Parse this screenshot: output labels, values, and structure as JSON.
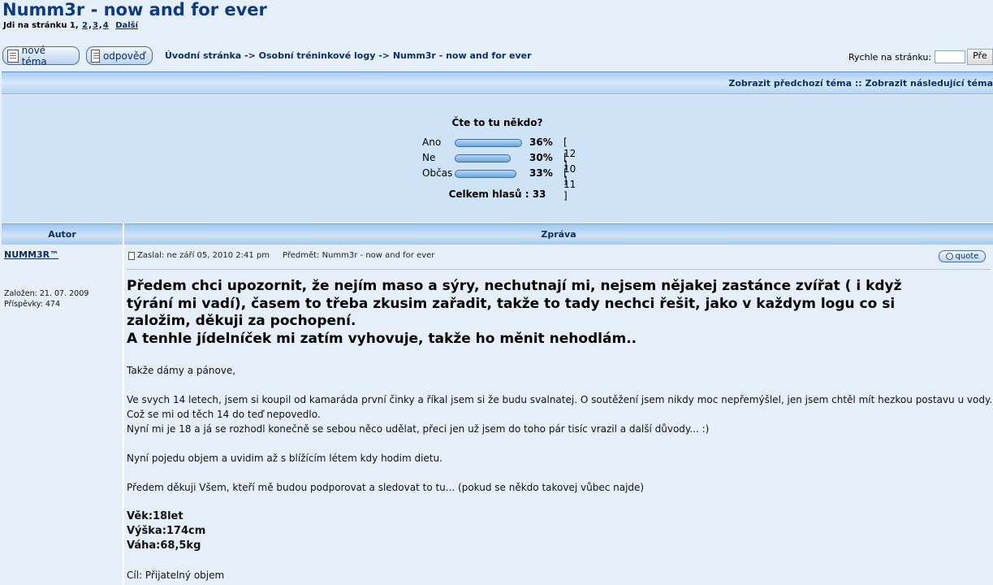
{
  "topic": {
    "title": "Numm3r - now and for ever"
  },
  "pager": {
    "prefix": "Jdi na stránku 1,",
    "pages": [
      "2",
      "3",
      "4"
    ],
    "next": "Další"
  },
  "buttons": {
    "new_topic": "nové téma",
    "reply": "odpověď"
  },
  "breadcrumb": {
    "text": "Úvodní stránka -> Osobní tréninkové logy -> Numm3r - now and for ever"
  },
  "quick_jump": {
    "label": "Rychle na stránku:",
    "value": "",
    "go": "Pře"
  },
  "nav": {
    "prev_next": "Zobrazit předchozí téma :: Zobrazit následující téma"
  },
  "poll": {
    "question": "Čte to tu někdo?",
    "options": [
      {
        "label": "Ano",
        "percent_text": "36%",
        "count_text": "[ 12 ]",
        "fill": 0.36
      },
      {
        "label": "Ne",
        "percent_text": "30%",
        "count_text": "[ 10 ]",
        "fill": 0.3
      },
      {
        "label": "Občas",
        "percent_text": "33%",
        "count_text": "[ 11 ]",
        "fill": 0.33
      }
    ],
    "total": "Celkem hlasů : 33"
  },
  "table": {
    "col_author": "Autor",
    "col_message": "Zpráva"
  },
  "post": {
    "author": "NUMM3R™",
    "joined": "Založen: 21. 07. 2009",
    "posts": "Příspěvky: 474",
    "posted": "Zaslal: ne září 05, 2010 2:41 pm",
    "subject": "Předmět: Numm3r - now and for ever",
    "quote_label": "quote",
    "big_lines": [
      "Předem chci upozornit, že nejím maso a sýry, nechutnají mi, nejsem nějakej zastánce zvířat ( i když",
      "týrání mi vadí), časem to třeba zkusim zařadit, takže to tady nechci řešit, jako v každym logu co si",
      "založim, děkuji za pochopení.",
      "A tenhle jídelníček mi zatím vyhovuje, takže ho měnit nehodlám.."
    ],
    "greeting": "Takže dámy a pánove,",
    "para1_l1": "Ve svych 14 letech, jsem si koupil od kamaráda první činky a říkal jsem si že budu svalnatej. O soutěžení jsem nikdy moc nepřemýšlel, jen jsem chtěl mít hezkou postavu u vody.",
    "para1_l2": "Což se mi od těch 14 do teď nepovedlo.",
    "para1_l3": "Nyní mi je 18 a já se rozhodl konečně se sebou něco udělat, přeci jen už jsem do toho pár tisíc vrazil a další důvody... :)",
    "para2": "Nyní pojedu objem a uvidim až s blížícím létem kdy hodim dietu.",
    "para3": "Předem děkuji Všem, kteří mě budou podporovat a sledovat to tu... (pokud se někdo takovej vůbec najde)",
    "age": "Věk:18let",
    "height": "Výška:174cm",
    "weight": "Váha:68,5kg",
    "goal": "Cíl: Přijatelný objem"
  }
}
